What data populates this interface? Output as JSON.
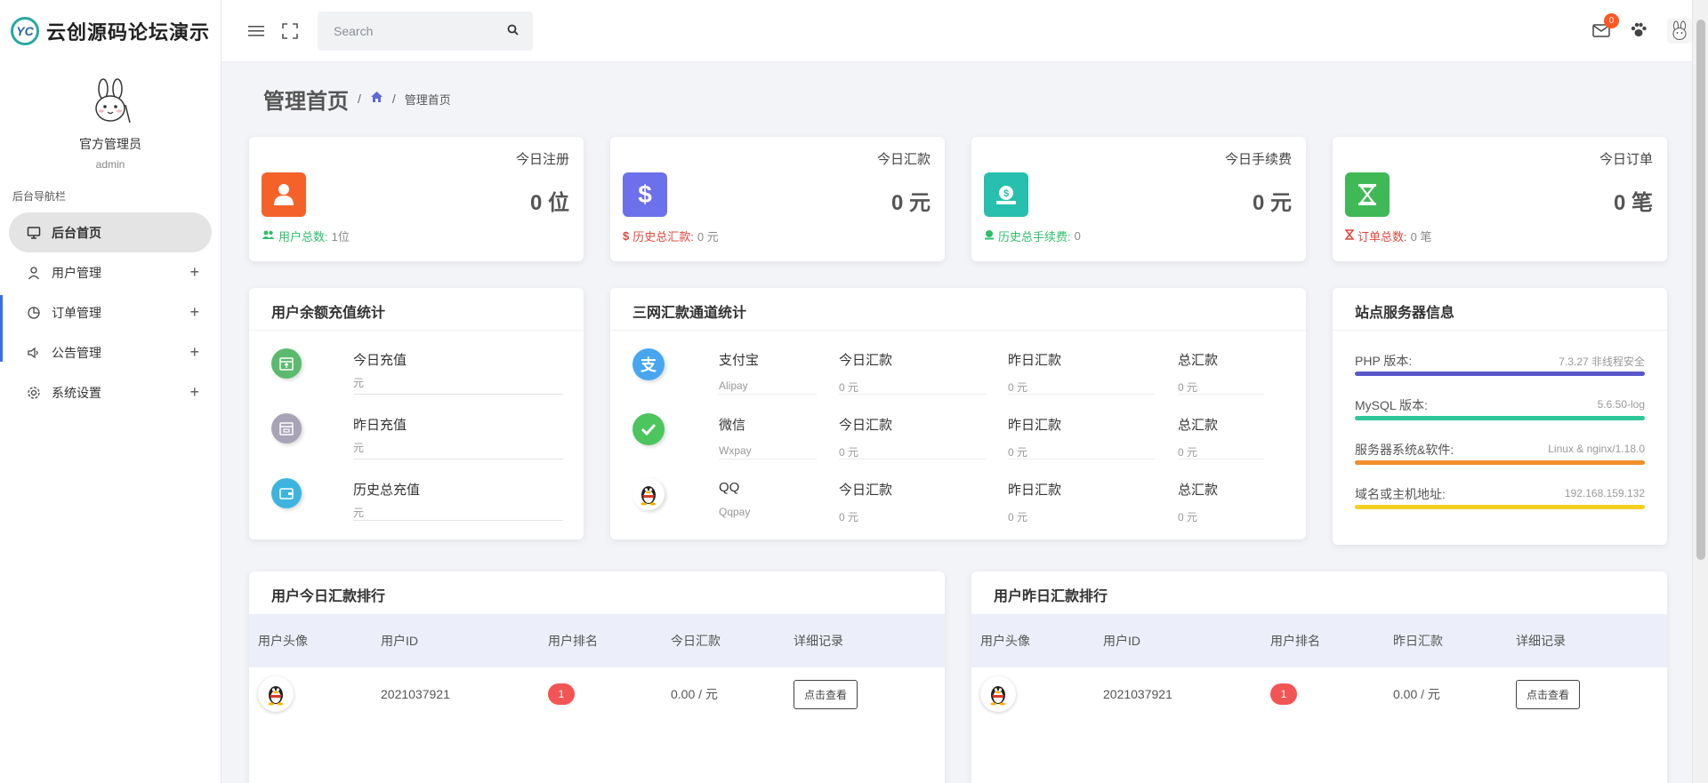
{
  "brand": {
    "name": "云创源码论坛演示",
    "logo_text": "YC"
  },
  "profile": {
    "name": "官方管理员",
    "role": "admin"
  },
  "nav": {
    "title": "后台导航栏",
    "items": [
      {
        "label": "后台首页",
        "icon": "monitor-icon",
        "active": true
      },
      {
        "label": "用户管理",
        "icon": "user-icon"
      },
      {
        "label": "订单管理",
        "icon": "pie-chart-icon"
      },
      {
        "label": "公告管理",
        "icon": "speaker-icon"
      },
      {
        "label": "系统设置",
        "icon": "gear-icon"
      }
    ]
  },
  "topbar": {
    "search_placeholder": "Search",
    "mail_count": "0"
  },
  "page": {
    "title": "管理首页",
    "breadcrumb_current": "管理首页"
  },
  "stats": [
    {
      "title": "今日注册",
      "value": "0 位",
      "foot_label": "用户总数:",
      "foot_value": "1位",
      "color": "#f4622a",
      "foot_color": "#2ebd6b"
    },
    {
      "title": "今日汇款",
      "value": "0 元",
      "foot_label": "历史总汇款:",
      "foot_value": "0 元",
      "color": "#6c70ea",
      "foot_color": "#e0483c"
    },
    {
      "title": "今日手续费",
      "value": "0 元",
      "foot_label": "历史总手续费:",
      "foot_value": "0",
      "color": "#27bfad",
      "foot_color": "#2ebd6b"
    },
    {
      "title": "今日订单",
      "value": "0 笔",
      "foot_label": "订单总数:",
      "foot_value": "0 笔",
      "color": "#3fb955",
      "foot_color": "#e0483c"
    }
  ],
  "recharge": {
    "title": "用户余额充值统计",
    "rows": [
      {
        "label": "今日充值",
        "sub": "元"
      },
      {
        "label": "昨日充值",
        "sub": "元"
      },
      {
        "label": "历史总充值",
        "sub": "元"
      }
    ]
  },
  "channels": {
    "title": "三网汇款通道统计",
    "col_today": "今日汇款",
    "col_yesterday": "昨日汇款",
    "col_total": "总汇款",
    "rows": [
      {
        "name": "支付宝",
        "code": "Alipay",
        "today": "0 元",
        "yesterday": "0 元",
        "total": "0 元"
      },
      {
        "name": "微信",
        "code": "Wxpay",
        "today": "0 元",
        "yesterday": "0 元",
        "total": "0 元"
      },
      {
        "name": "QQ",
        "code": "Qqpay",
        "today": "0 元",
        "yesterday": "0 元",
        "total": "0 元"
      }
    ]
  },
  "server": {
    "title": "站点服务器信息",
    "items": [
      {
        "label": "PHP 版本:",
        "value": "7.3.27 非线程安全"
      },
      {
        "label": "MySQL 版本:",
        "value": "5.6.50-log"
      },
      {
        "label": "服务器系统&软件:",
        "value": "Linux & nginx/1.18.0"
      },
      {
        "label": "域名或主机地址:",
        "value": "192.168.159.132"
      }
    ]
  },
  "rank_today": {
    "title": "用户今日汇款排行",
    "headers": [
      "用户头像",
      "用户ID",
      "用户排名",
      "今日汇款",
      "详细记录"
    ],
    "rows": [
      {
        "user_id": "2021037921",
        "rank": "1",
        "amount": "0.00 / 元",
        "action": "点击查看"
      }
    ]
  },
  "rank_yesterday": {
    "title": "用户昨日汇款排行",
    "headers": [
      "用户头像",
      "用户ID",
      "用户排名",
      "昨日汇款",
      "详细记录"
    ],
    "rows": [
      {
        "user_id": "2021037921",
        "rank": "1",
        "amount": "0.00 / 元",
        "action": "点击查看"
      }
    ]
  }
}
